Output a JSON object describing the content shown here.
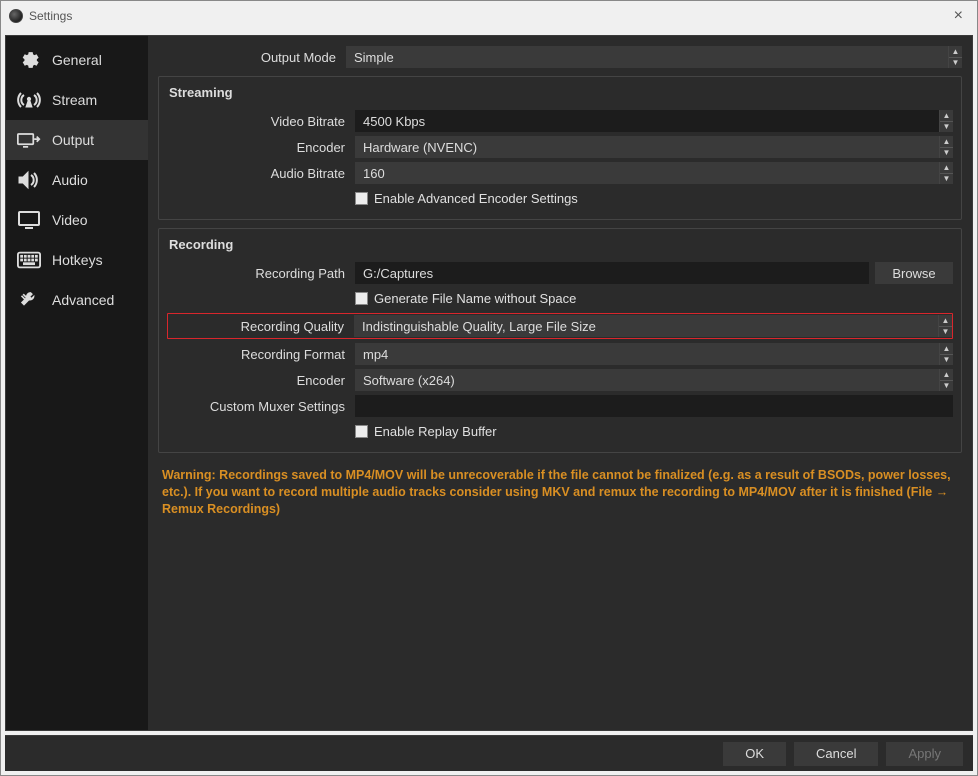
{
  "window": {
    "title": "Settings"
  },
  "sidebar": {
    "items": [
      {
        "label": "General"
      },
      {
        "label": "Stream"
      },
      {
        "label": "Output"
      },
      {
        "label": "Audio"
      },
      {
        "label": "Video"
      },
      {
        "label": "Hotkeys"
      },
      {
        "label": "Advanced"
      }
    ]
  },
  "output": {
    "mode_label": "Output Mode",
    "mode_value": "Simple"
  },
  "streaming": {
    "title": "Streaming",
    "video_bitrate_label": "Video Bitrate",
    "video_bitrate_value": "4500 Kbps",
    "encoder_label": "Encoder",
    "encoder_value": "Hardware (NVENC)",
    "audio_bitrate_label": "Audio Bitrate",
    "audio_bitrate_value": "160",
    "advanced_checkbox": "Enable Advanced Encoder Settings"
  },
  "recording": {
    "title": "Recording",
    "path_label": "Recording Path",
    "path_value": "G:/Captures",
    "browse_label": "Browse",
    "filename_checkbox": "Generate File Name without Space",
    "quality_label": "Recording Quality",
    "quality_value": "Indistinguishable Quality, Large File Size",
    "format_label": "Recording Format",
    "format_value": "mp4",
    "encoder_label": "Encoder",
    "encoder_value": "Software (x264)",
    "muxer_label": "Custom Muxer Settings",
    "muxer_value": "",
    "replay_checkbox": "Enable Replay Buffer"
  },
  "warning": "Warning: Recordings saved to MP4/MOV will be unrecoverable if the file cannot be finalized (e.g. as a result of BSODs, power losses, etc.). If you want to record multiple audio tracks consider using MKV and remux the recording to MP4/MOV after it is finished (File → Remux Recordings)",
  "footer": {
    "ok": "OK",
    "cancel": "Cancel",
    "apply": "Apply"
  }
}
